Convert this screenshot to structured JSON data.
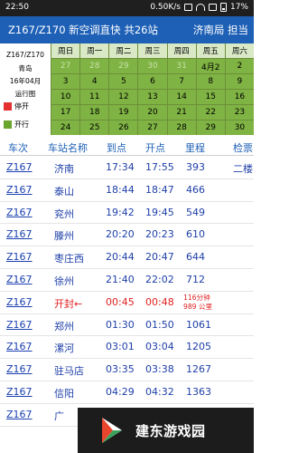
{
  "status_bar": {
    "time": "22:50",
    "network_speed": "0.50K/s",
    "battery": "17%"
  },
  "title_bar": {
    "title": "Z167/Z170 新空调直快 共26站",
    "bureau": "济南局 担当"
  },
  "calendar": {
    "info_lines": [
      "Z167/Z170",
      "青岛",
      "16年04月",
      "运行图"
    ],
    "legend": [
      {
        "label": "停开",
        "color": "#e53030"
      },
      {
        "label": "开行",
        "color": "#6aa52e"
      }
    ],
    "weekdays": [
      "周日",
      "周一",
      "周二",
      "周三",
      "周四",
      "周五",
      "周六"
    ],
    "weeks": [
      [
        "27",
        "28",
        "29",
        "30",
        "31",
        "4月2",
        "2"
      ],
      [
        "3",
        "4",
        "5",
        "6",
        "7",
        "8",
        "9"
      ],
      [
        "10",
        "11",
        "12",
        "13",
        "14",
        "15",
        "16"
      ],
      [
        "17",
        "18",
        "19",
        "20",
        "21",
        "22",
        "23"
      ],
      [
        "24",
        "25",
        "26",
        "27",
        "28",
        "29",
        "30"
      ]
    ]
  },
  "table": {
    "headers": {
      "train": "车次",
      "station": "车站名称",
      "arrive": "到点",
      "depart": "开点",
      "distance": "里程",
      "extra": "检票"
    },
    "rows": [
      {
        "train": "Z167",
        "station": "济南",
        "arrive": "17:34",
        "depart": "17:55",
        "distance": "393",
        "extra": "二楼"
      },
      {
        "train": "Z167",
        "station": "泰山",
        "arrive": "18:44",
        "depart": "18:47",
        "distance": "466",
        "extra": ""
      },
      {
        "train": "Z167",
        "station": "兖州",
        "arrive": "19:42",
        "depart": "19:45",
        "distance": "549",
        "extra": ""
      },
      {
        "train": "Z167",
        "station": "滕州",
        "arrive": "20:20",
        "depart": "20:23",
        "distance": "610",
        "extra": ""
      },
      {
        "train": "Z167",
        "station": "枣庄西",
        "arrive": "20:44",
        "depart": "20:47",
        "distance": "644",
        "extra": ""
      },
      {
        "train": "Z167",
        "station": "徐州",
        "arrive": "21:40",
        "depart": "22:02",
        "distance": "712",
        "extra": ""
      },
      {
        "train": "Z167",
        "station": "开封←",
        "arrive": "00:45",
        "depart": "00:48",
        "distance": "",
        "extra": "",
        "note_line1": "116分钟",
        "note_line2": "989 公里"
      },
      {
        "train": "Z167",
        "station": "郑州",
        "arrive": "01:30",
        "depart": "01:50",
        "distance": "1061",
        "extra": ""
      },
      {
        "train": "Z167",
        "station": "漯河",
        "arrive": "03:01",
        "depart": "03:04",
        "distance": "1205",
        "extra": ""
      },
      {
        "train": "Z167",
        "station": "驻马店",
        "arrive": "03:35",
        "depart": "03:38",
        "distance": "1267",
        "extra": ""
      },
      {
        "train": "Z167",
        "station": "信阳",
        "arrive": "04:29",
        "depart": "04:32",
        "distance": "1363",
        "extra": ""
      },
      {
        "train": "Z167",
        "station": "广",
        "arrive": "",
        "depart": "",
        "distance": "",
        "extra": ""
      }
    ]
  },
  "ad_overlay": {
    "text": "建东游戏园"
  },
  "colors": {
    "accent": "#1e60b6",
    "calendar_cell": "#7fb343",
    "current_station": "#e02020"
  }
}
